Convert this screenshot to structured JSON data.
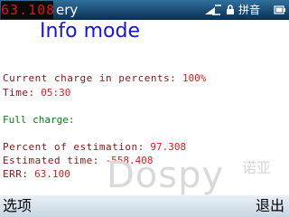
{
  "status_bar": {
    "time": "63.108",
    "app_title": "ery",
    "ime_label": "拼音",
    "icons": [
      "signal-icon",
      "lock-icon",
      "battery-icon"
    ],
    "time_color": "#e0141a"
  },
  "main": {
    "title": "Info mode",
    "title_color": "#1818c8",
    "charge": {
      "label": "Current charge in percents:",
      "value": "100%"
    },
    "time": {
      "label": "Time:",
      "value": "05:30"
    },
    "section_header": "Full charge:",
    "estimates": [
      {
        "label": "Percent of estimation:",
        "value": "97.308"
      },
      {
        "label": "Estimated time:",
        "value": "-558.408"
      },
      {
        "label": "ERR:",
        "value": "63.100"
      }
    ],
    "value_color": "#d21e1e",
    "header_color": "#0b7a16"
  },
  "watermark": {
    "text": "Dospy",
    "text_cn": "诺亚"
  },
  "softkeys": {
    "left": "选项",
    "right": "退出"
  }
}
